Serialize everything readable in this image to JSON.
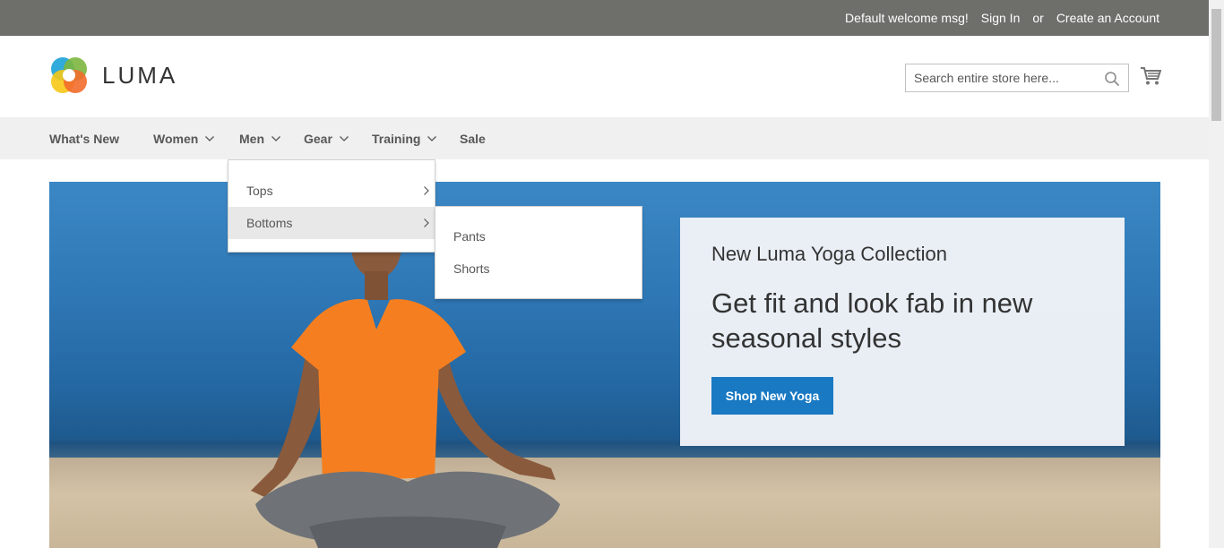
{
  "top_bar": {
    "welcome": "Default welcome msg!",
    "sign_in": "Sign In",
    "or": "or",
    "create_account": "Create an Account"
  },
  "header": {
    "logo_text": "LUMA",
    "search_placeholder": "Search entire store here...",
    "cart_icon": "cart-icon",
    "search_icon": "magnifier-icon"
  },
  "nav": {
    "items": [
      {
        "label": "What's New",
        "has_dropdown": false
      },
      {
        "label": "Women",
        "has_dropdown": true
      },
      {
        "label": "Men",
        "has_dropdown": true
      },
      {
        "label": "Gear",
        "has_dropdown": true
      },
      {
        "label": "Training",
        "has_dropdown": true
      },
      {
        "label": "Sale",
        "has_dropdown": false
      }
    ]
  },
  "men_menu": {
    "items": [
      {
        "label": "Tops"
      },
      {
        "label": "Bottoms",
        "active": true
      }
    ]
  },
  "bottoms_menu": {
    "items": [
      {
        "label": "Pants"
      },
      {
        "label": "Shorts"
      }
    ]
  },
  "hero": {
    "subtitle": "New Luma Yoga Collection",
    "title": "Get fit and look fab in new seasonal styles",
    "button": "Shop New Yoga"
  },
  "colors": {
    "top_bar_bg": "#6e6e6b",
    "nav_bg": "#f0f0f0",
    "button_blue": "#1979c3"
  }
}
